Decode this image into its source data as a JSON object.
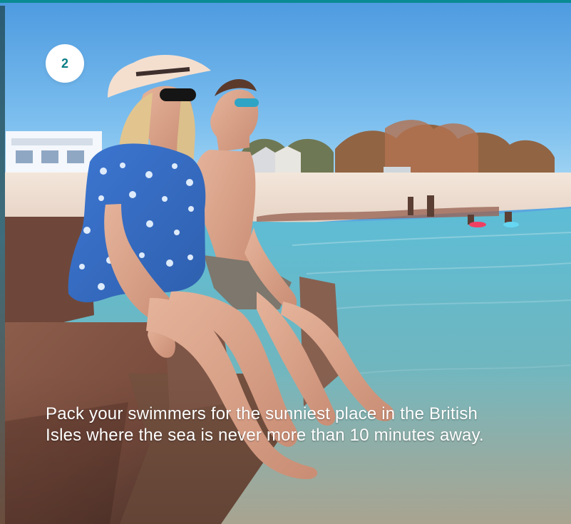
{
  "badge": {
    "number": "2"
  },
  "caption": {
    "text": "Pack your swimmers for the sunniest place in the British Isles where the sea is never more than 10 minutes away."
  },
  "colors": {
    "accent": "#0a8a92",
    "badge_text": "#0a7d84",
    "badge_bg": "#ffffff",
    "caption_text": "#ffffff",
    "sky": "#5aa6df",
    "sea": "#69a7b5",
    "sand": "#efe0d2",
    "rock": "#8e5e4b"
  },
  "image": {
    "subject": "beach scene with two people sitting on rocks by the sea"
  }
}
